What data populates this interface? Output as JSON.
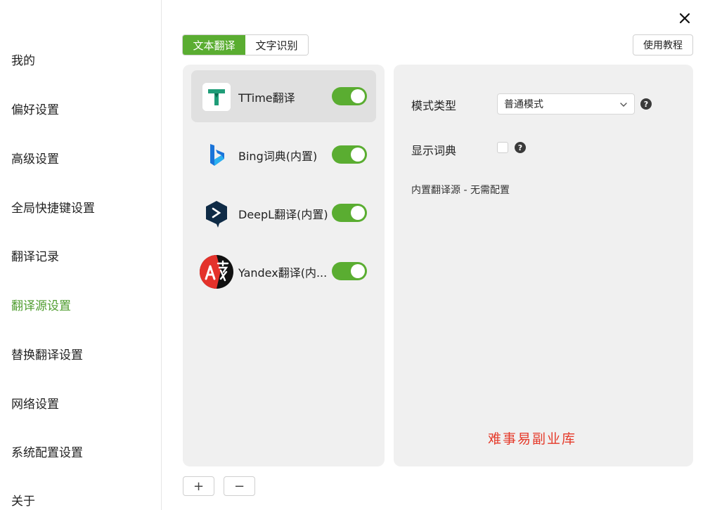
{
  "window": {
    "close_icon": "close-icon"
  },
  "sidebar": {
    "items": [
      {
        "label": "我的"
      },
      {
        "label": "偏好设置"
      },
      {
        "label": "高级设置"
      },
      {
        "label": "全局快捷键设置"
      },
      {
        "label": "翻译记录"
      },
      {
        "label": "翻译源设置",
        "active": true
      },
      {
        "label": "替换翻译设置"
      },
      {
        "label": "网络设置"
      },
      {
        "label": "系统配置设置"
      },
      {
        "label": "关于"
      }
    ],
    "active_color": "#4f9d2f"
  },
  "tabs": [
    {
      "label": "文本翻译",
      "active": true
    },
    {
      "label": "文字识别"
    }
  ],
  "help_button": "使用教程",
  "services": [
    {
      "label": "TTime翻译",
      "icon": "ttime-icon",
      "enabled": true,
      "selected": true
    },
    {
      "label": "Bing词典(内置)",
      "icon": "bing-icon",
      "enabled": true
    },
    {
      "label": "DeepL翻译(内置)",
      "icon": "deepl-icon",
      "enabled": true
    },
    {
      "label": "Yandex翻译(内...",
      "icon": "yandex-icon",
      "enabled": true
    }
  ],
  "list_actions": {
    "add": "+",
    "remove": "−"
  },
  "config": {
    "mode_label": "模式类型",
    "mode_value": "普通模式",
    "dict_label": "显示词典",
    "dict_checked": false,
    "help_glyph": "?",
    "note": "内置翻译源 - 无需配置"
  },
  "watermark": "难事易副业库",
  "colors": {
    "accent": "#5aad31",
    "watermark": "#e53a2a"
  }
}
